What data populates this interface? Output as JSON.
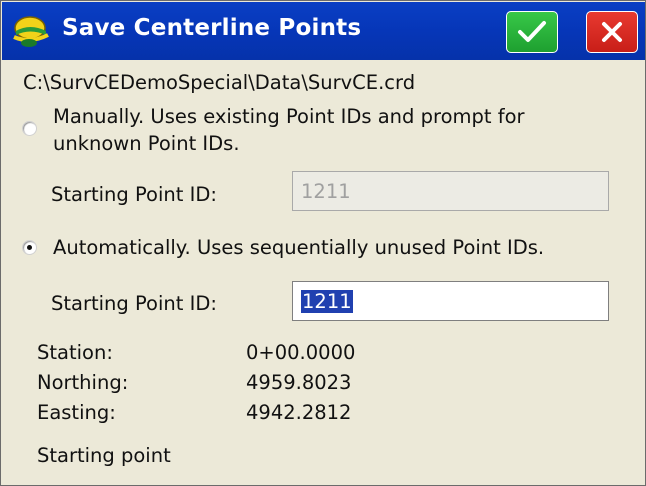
{
  "window": {
    "title": "Save Centerline Points",
    "ok_icon": "checkmark-icon",
    "close_icon": "close-icon",
    "colors": {
      "titlebar": "#0636b8",
      "ok": "#1ea030",
      "close": "#c81e18"
    }
  },
  "file_path": "C:\\SurvCEDemoSpecial\\Data\\SurvCE.crd",
  "manual_option": {
    "line1": "Manually. Uses existing Point IDs and prompt for",
    "line2": "unknown Point IDs.",
    "selected": false,
    "field_label": "Starting Point ID:",
    "field_value": "1211",
    "enabled": false
  },
  "auto_option": {
    "label": "Automatically. Uses sequentially unused Point IDs.",
    "selected": true,
    "field_label": "Starting Point ID:",
    "field_value": "1211",
    "enabled": true
  },
  "info": [
    {
      "label": "Station:",
      "value": "0+00.0000"
    },
    {
      "label": "Northing:",
      "value": "4959.8023"
    },
    {
      "label": "Easting:",
      "value": "4942.2812"
    }
  ],
  "status_text": "Starting point"
}
